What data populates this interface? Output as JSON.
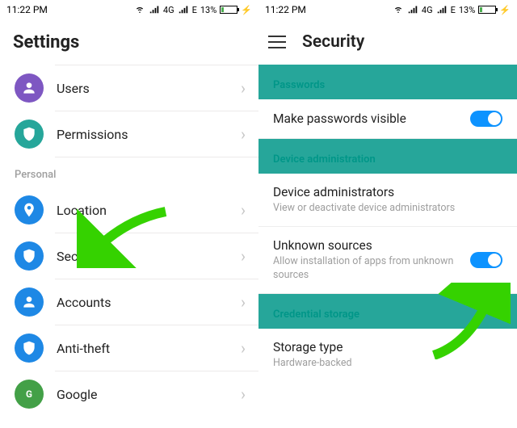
{
  "statusbar": {
    "time": "11:22 PM",
    "net4g": "4G",
    "netE": "E",
    "battery_pct": "13%"
  },
  "left": {
    "title": "Settings",
    "items": [
      {
        "label": "Users"
      },
      {
        "label": "Permissions"
      }
    ],
    "personal_header": "Personal",
    "personal": [
      {
        "label": "Location"
      },
      {
        "label": "Security"
      },
      {
        "label": "Accounts"
      },
      {
        "label": "Anti-theft"
      },
      {
        "label": "Google"
      }
    ]
  },
  "right": {
    "title": "Security",
    "section_passwords": "Passwords",
    "make_passwords_visible": "Make passwords visible",
    "section_device_admin": "Device administration",
    "device_admins": {
      "title": "Device administrators",
      "sub": "View or deactivate device administrators"
    },
    "unknown_sources": {
      "title": "Unknown sources",
      "sub": "Allow installation of apps from unknown sources"
    },
    "section_credential": "Credential storage",
    "storage_type": {
      "title": "Storage type",
      "sub": "Hardware-backed"
    }
  }
}
